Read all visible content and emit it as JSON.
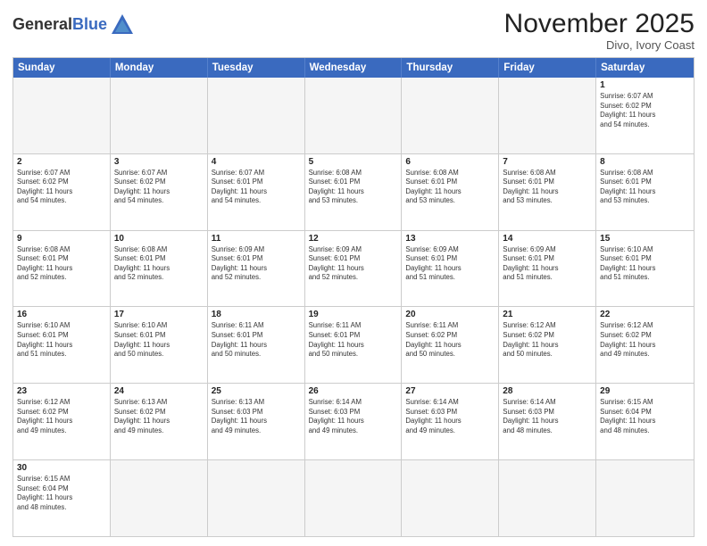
{
  "header": {
    "logo_general": "General",
    "logo_blue": "Blue",
    "month_title": "November 2025",
    "location": "Divo, Ivory Coast"
  },
  "days_of_week": [
    "Sunday",
    "Monday",
    "Tuesday",
    "Wednesday",
    "Thursday",
    "Friday",
    "Saturday"
  ],
  "weeks": [
    [
      {
        "day": "",
        "empty": true,
        "lines": []
      },
      {
        "day": "",
        "empty": true,
        "lines": []
      },
      {
        "day": "",
        "empty": true,
        "lines": []
      },
      {
        "day": "",
        "empty": true,
        "lines": []
      },
      {
        "day": "",
        "empty": true,
        "lines": []
      },
      {
        "day": "",
        "empty": true,
        "lines": []
      },
      {
        "day": "1",
        "empty": false,
        "lines": [
          "Sunrise: 6:07 AM",
          "Sunset: 6:02 PM",
          "Daylight: 11 hours",
          "and 54 minutes."
        ]
      }
    ],
    [
      {
        "day": "2",
        "empty": false,
        "lines": [
          "Sunrise: 6:07 AM",
          "Sunset: 6:02 PM",
          "Daylight: 11 hours",
          "and 54 minutes."
        ]
      },
      {
        "day": "3",
        "empty": false,
        "lines": [
          "Sunrise: 6:07 AM",
          "Sunset: 6:02 PM",
          "Daylight: 11 hours",
          "and 54 minutes."
        ]
      },
      {
        "day": "4",
        "empty": false,
        "lines": [
          "Sunrise: 6:07 AM",
          "Sunset: 6:01 PM",
          "Daylight: 11 hours",
          "and 54 minutes."
        ]
      },
      {
        "day": "5",
        "empty": false,
        "lines": [
          "Sunrise: 6:08 AM",
          "Sunset: 6:01 PM",
          "Daylight: 11 hours",
          "and 53 minutes."
        ]
      },
      {
        "day": "6",
        "empty": false,
        "lines": [
          "Sunrise: 6:08 AM",
          "Sunset: 6:01 PM",
          "Daylight: 11 hours",
          "and 53 minutes."
        ]
      },
      {
        "day": "7",
        "empty": false,
        "lines": [
          "Sunrise: 6:08 AM",
          "Sunset: 6:01 PM",
          "Daylight: 11 hours",
          "and 53 minutes."
        ]
      },
      {
        "day": "8",
        "empty": false,
        "lines": [
          "Sunrise: 6:08 AM",
          "Sunset: 6:01 PM",
          "Daylight: 11 hours",
          "and 53 minutes."
        ]
      }
    ],
    [
      {
        "day": "9",
        "empty": false,
        "lines": [
          "Sunrise: 6:08 AM",
          "Sunset: 6:01 PM",
          "Daylight: 11 hours",
          "and 52 minutes."
        ]
      },
      {
        "day": "10",
        "empty": false,
        "lines": [
          "Sunrise: 6:08 AM",
          "Sunset: 6:01 PM",
          "Daylight: 11 hours",
          "and 52 minutes."
        ]
      },
      {
        "day": "11",
        "empty": false,
        "lines": [
          "Sunrise: 6:09 AM",
          "Sunset: 6:01 PM",
          "Daylight: 11 hours",
          "and 52 minutes."
        ]
      },
      {
        "day": "12",
        "empty": false,
        "lines": [
          "Sunrise: 6:09 AM",
          "Sunset: 6:01 PM",
          "Daylight: 11 hours",
          "and 52 minutes."
        ]
      },
      {
        "day": "13",
        "empty": false,
        "lines": [
          "Sunrise: 6:09 AM",
          "Sunset: 6:01 PM",
          "Daylight: 11 hours",
          "and 51 minutes."
        ]
      },
      {
        "day": "14",
        "empty": false,
        "lines": [
          "Sunrise: 6:09 AM",
          "Sunset: 6:01 PM",
          "Daylight: 11 hours",
          "and 51 minutes."
        ]
      },
      {
        "day": "15",
        "empty": false,
        "lines": [
          "Sunrise: 6:10 AM",
          "Sunset: 6:01 PM",
          "Daylight: 11 hours",
          "and 51 minutes."
        ]
      }
    ],
    [
      {
        "day": "16",
        "empty": false,
        "lines": [
          "Sunrise: 6:10 AM",
          "Sunset: 6:01 PM",
          "Daylight: 11 hours",
          "and 51 minutes."
        ]
      },
      {
        "day": "17",
        "empty": false,
        "lines": [
          "Sunrise: 6:10 AM",
          "Sunset: 6:01 PM",
          "Daylight: 11 hours",
          "and 50 minutes."
        ]
      },
      {
        "day": "18",
        "empty": false,
        "lines": [
          "Sunrise: 6:11 AM",
          "Sunset: 6:01 PM",
          "Daylight: 11 hours",
          "and 50 minutes."
        ]
      },
      {
        "day": "19",
        "empty": false,
        "lines": [
          "Sunrise: 6:11 AM",
          "Sunset: 6:01 PM",
          "Daylight: 11 hours",
          "and 50 minutes."
        ]
      },
      {
        "day": "20",
        "empty": false,
        "lines": [
          "Sunrise: 6:11 AM",
          "Sunset: 6:02 PM",
          "Daylight: 11 hours",
          "and 50 minutes."
        ]
      },
      {
        "day": "21",
        "empty": false,
        "lines": [
          "Sunrise: 6:12 AM",
          "Sunset: 6:02 PM",
          "Daylight: 11 hours",
          "and 50 minutes."
        ]
      },
      {
        "day": "22",
        "empty": false,
        "lines": [
          "Sunrise: 6:12 AM",
          "Sunset: 6:02 PM",
          "Daylight: 11 hours",
          "and 49 minutes."
        ]
      }
    ],
    [
      {
        "day": "23",
        "empty": false,
        "lines": [
          "Sunrise: 6:12 AM",
          "Sunset: 6:02 PM",
          "Daylight: 11 hours",
          "and 49 minutes."
        ]
      },
      {
        "day": "24",
        "empty": false,
        "lines": [
          "Sunrise: 6:13 AM",
          "Sunset: 6:02 PM",
          "Daylight: 11 hours",
          "and 49 minutes."
        ]
      },
      {
        "day": "25",
        "empty": false,
        "lines": [
          "Sunrise: 6:13 AM",
          "Sunset: 6:03 PM",
          "Daylight: 11 hours",
          "and 49 minutes."
        ]
      },
      {
        "day": "26",
        "empty": false,
        "lines": [
          "Sunrise: 6:14 AM",
          "Sunset: 6:03 PM",
          "Daylight: 11 hours",
          "and 49 minutes."
        ]
      },
      {
        "day": "27",
        "empty": false,
        "lines": [
          "Sunrise: 6:14 AM",
          "Sunset: 6:03 PM",
          "Daylight: 11 hours",
          "and 49 minutes."
        ]
      },
      {
        "day": "28",
        "empty": false,
        "lines": [
          "Sunrise: 6:14 AM",
          "Sunset: 6:03 PM",
          "Daylight: 11 hours",
          "and 48 minutes."
        ]
      },
      {
        "day": "29",
        "empty": false,
        "lines": [
          "Sunrise: 6:15 AM",
          "Sunset: 6:04 PM",
          "Daylight: 11 hours",
          "and 48 minutes."
        ]
      }
    ],
    [
      {
        "day": "30",
        "empty": false,
        "lines": [
          "Sunrise: 6:15 AM",
          "Sunset: 6:04 PM",
          "Daylight: 11 hours",
          "and 48 minutes."
        ]
      },
      {
        "day": "",
        "empty": true,
        "lines": []
      },
      {
        "day": "",
        "empty": true,
        "lines": []
      },
      {
        "day": "",
        "empty": true,
        "lines": []
      },
      {
        "day": "",
        "empty": true,
        "lines": []
      },
      {
        "day": "",
        "empty": true,
        "lines": []
      },
      {
        "day": "",
        "empty": true,
        "lines": []
      }
    ]
  ]
}
